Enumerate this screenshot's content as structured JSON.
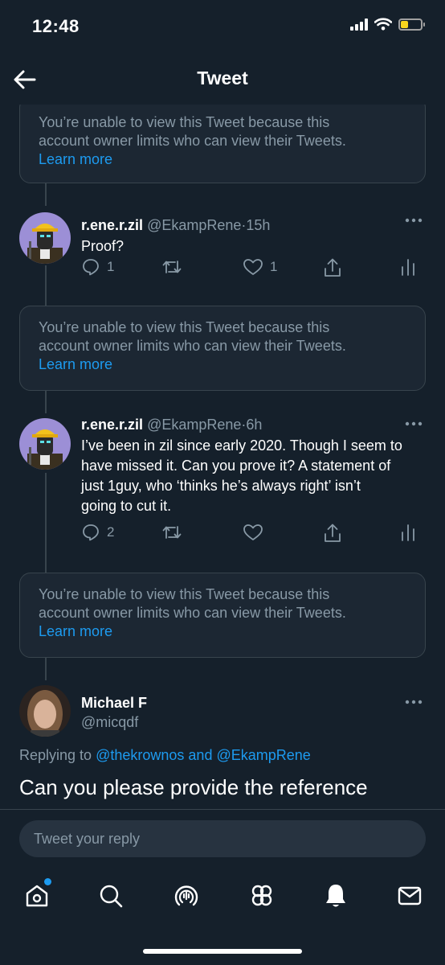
{
  "status_bar": {
    "time": "12:48",
    "battery_level": 0.35,
    "battery_color": "#f7d51d"
  },
  "header": {
    "title": "Tweet"
  },
  "restricted_notice": {
    "line1": "You’re unable to view this Tweet because this",
    "line2": "account owner limits who can view their Tweets.",
    "learn_more": "Learn more"
  },
  "tweets": [
    {
      "name": "r.ene.r.zil",
      "handle": "@EkampRene",
      "separator": "·",
      "time": "15h",
      "text_lines": [
        "Proof?"
      ],
      "replies": "1",
      "retweets": "",
      "likes": "1"
    },
    {
      "name": "r.ene.r.zil",
      "handle": "@EkampRene",
      "separator": "·",
      "time": "6h",
      "text_lines": [
        "I’ve been in zil since early 2020. Though I seem to",
        "have missed it. Can you prove it? A statement of",
        "just 1guy, who ‘thinks he’s always right’ isn’t",
        "going to cut it."
      ],
      "replies": "2",
      "retweets": "",
      "likes": ""
    }
  ],
  "main_tweet": {
    "name": "Michael F",
    "handle": "@micqdf",
    "replying_prefix": "Replying to",
    "replying_user1": "@thekrownos",
    "replying_and": "and",
    "replying_user2": "@EkampRene",
    "text": "Can you please provide the reference"
  },
  "reply_box": {
    "placeholder": "Tweet your reply"
  },
  "tab_bar": {
    "items": [
      {
        "icon": "home-icon",
        "has_notification_dot": true
      },
      {
        "icon": "search-icon"
      },
      {
        "icon": "spaces-icon"
      },
      {
        "icon": "communities-icon"
      },
      {
        "icon": "notifications-icon"
      },
      {
        "icon": "messages-icon"
      }
    ]
  },
  "colors": {
    "background": "#15202b",
    "card_background": "#1c2733",
    "border": "#38444d",
    "secondary_text": "#8899a6",
    "accent": "#1d9bf0"
  }
}
